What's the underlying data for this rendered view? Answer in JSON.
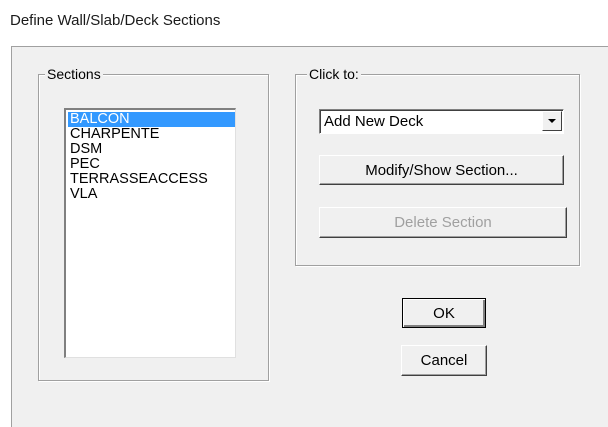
{
  "window": {
    "title": "Define Wall/Slab/Deck Sections"
  },
  "sections": {
    "label": "Sections",
    "items": [
      "BALCON",
      "CHARPENTE",
      "DSM",
      "PEC",
      "TERRASSEACCESS",
      "VLA"
    ],
    "selected": "BALCON"
  },
  "click_to": {
    "label": "Click to:",
    "dropdown_value": "Add New Deck",
    "modify_label": "Modify/Show Section...",
    "delete_label": "Delete Section"
  },
  "actions": {
    "ok_label": "OK",
    "cancel_label": "Cancel"
  },
  "colors": {
    "selection": "#3399ff",
    "dialog_bg": "#f0f0f0",
    "disabled_text": "#a0a0a0"
  },
  "icons": {
    "dropdown": "chevron-down-icon"
  }
}
